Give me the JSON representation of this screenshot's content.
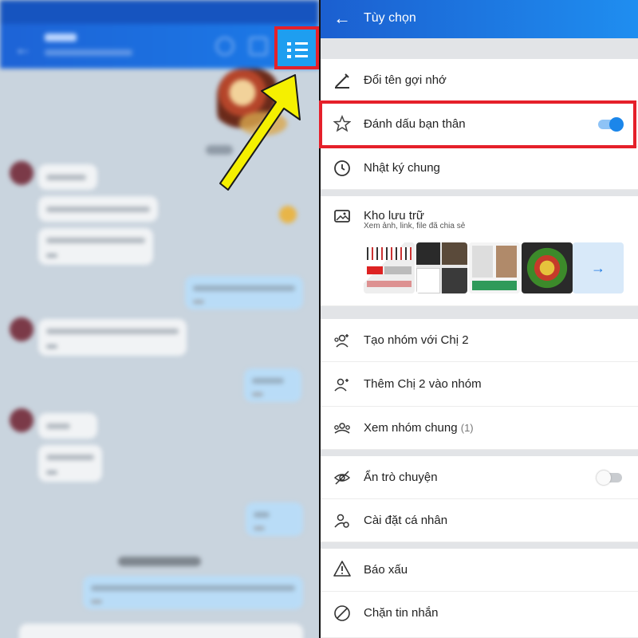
{
  "options": {
    "title": "Tùy chọn",
    "items": [
      {
        "label": "Đổi tên gợi nhớ",
        "icon": "pencil-icon"
      },
      {
        "label": "Đánh dấu bạn thân",
        "icon": "star-icon",
        "toggle": true
      },
      {
        "label": "Nhật ký chung",
        "icon": "clock-icon"
      },
      {
        "label": "Kho lưu trữ",
        "icon": "image-icon",
        "subtitle": "Xem ảnh, link, file đã chia sẻ"
      },
      {
        "label": "Tạo nhóm với Chị 2",
        "icon": "add-group-icon"
      },
      {
        "label": "Thêm Chị 2  vào nhóm",
        "icon": "add-user-icon"
      },
      {
        "label": "Xem nhóm chung",
        "icon": "group-icon",
        "count": "(1)"
      },
      {
        "label": "Ẩn trò chuyện",
        "icon": "eye-off-icon",
        "toggle": false
      },
      {
        "label": "Cài đặt cá nhân",
        "icon": "user-settings-icon"
      },
      {
        "label": "Báo xấu",
        "icon": "warning-icon"
      },
      {
        "label": "Chặn tin nhắn",
        "icon": "block-icon"
      }
    ],
    "next_arrow": "→"
  },
  "chat": {
    "back": "←",
    "menu_icon": "list-menu-icon"
  },
  "colors": {
    "accent": "#1b86ea",
    "highlight": "#e5202a",
    "arrow": "#f5f000"
  }
}
